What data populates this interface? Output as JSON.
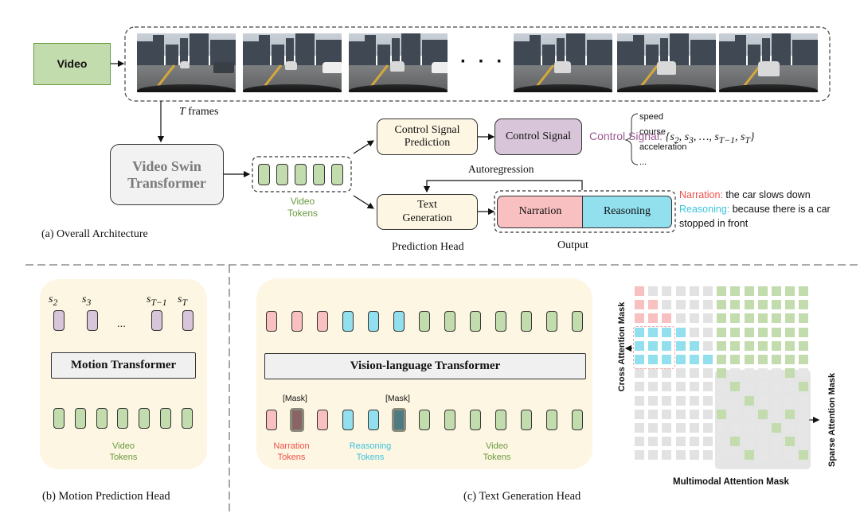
{
  "figure": {
    "overall": {
      "video_label": "Video",
      "frames_label_var": "T",
      "frames_label_text": " frames",
      "ellipsis": "· · ·",
      "frame_count_shown": 6,
      "swin_label_line1": "Video Swin",
      "swin_label_line2": "Transformer",
      "video_tokens_line1": "Video",
      "video_tokens_line2": "Tokens",
      "video_token_count": 5,
      "control_prediction_line1": "Control Signal",
      "control_prediction_line2": "Prediction",
      "control_signal_box": "Control Signal",
      "control_signal_prefix": "Control Signal: ",
      "control_signal_set": "{s₂, s₃, …, s_{T−1}, s_T}",
      "control_signal_items": [
        "speed",
        "course",
        "acceleration",
        "..."
      ],
      "autoregression_label": "Autoregression",
      "text_generation_line1": "Text",
      "text_generation_line2": "Generation",
      "narration_box": "Narration",
      "reasoning_box": "Reasoning",
      "prediction_head_label": "Prediction Head",
      "output_label": "Output",
      "example": {
        "narration_key": "Narration:",
        "narration_value": " the car slows down",
        "reasoning_key": "Reasoning:",
        "reasoning_value": " because there is a car",
        "reasoning_value_line2": "stopped in front"
      },
      "caption": "(a) Overall Architecture"
    },
    "motion_head": {
      "signal_labels": [
        "s₂",
        "s₃",
        "s_{T−1}",
        "s_T"
      ],
      "signal_ellipsis": "...",
      "transformer_label": "Motion Transformer",
      "video_token_count": 7,
      "tokens_line1": "Video",
      "tokens_line2": "Tokens",
      "caption": "(b) Motion Prediction Head"
    },
    "text_head": {
      "top_tokens": [
        "narration",
        "narration",
        "narration",
        "reasoning",
        "reasoning",
        "reasoning",
        "video",
        "video",
        "video",
        "video",
        "video",
        "video",
        "video"
      ],
      "bottom_tokens": [
        "narration",
        "narration-mask",
        "narration",
        "reasoning",
        "reasoning",
        "reasoning-mask",
        "video",
        "video",
        "video",
        "video",
        "video",
        "video",
        "video"
      ],
      "mask_label": "[Mask]",
      "transformer_label": "Vision-language Transformer",
      "narration_tokens_line1": "Narration",
      "narration_tokens_line2": "Tokens",
      "reasoning_tokens_line1": "Reasoning",
      "reasoning_tokens_line2": "Tokens",
      "video_tokens_line1": "Video",
      "video_tokens_line2": "Tokens",
      "caption": "(c) Text Generation Head"
    },
    "attention_mask": {
      "cross_label": "Cross Attention Mask",
      "sparse_label": "Sparse Attention Mask",
      "title": "Multimodal Attention Mask",
      "grid_size": 13,
      "rows": [
        "NGGGGGVVVVVVV",
        "NNGGGGVVVVVVV",
        "NNNGGGVVVVVVV",
        "RRRRGGVVVVVVV",
        "RRRRRGVVVVVVV",
        "RRRRRRVVVVVVV",
        "GGGGGGVssssVs",
        "GGGGGGsVssssV",
        "GGGGGGssVssss",
        "GGGGGGVssVsVs",
        "GGGGGGssssVss",
        "GGGGGGsVsssVs",
        "GGGGGGssVsssV"
      ],
      "legend": {
        "N": "narration",
        "R": "reasoning",
        "V": "video-attended",
        "G": "masked",
        "s": "sparse-masked"
      }
    },
    "colors": {
      "green": "#c2dcae",
      "pink": "#f8c0c0",
      "cyan": "#92dfee",
      "purple": "#d9c5d9",
      "cream": "#fdf6e3",
      "light_gray": "#f0f0f0",
      "narration_text": "#f0504a",
      "reasoning_text": "#3cc3dc",
      "video_text": "#6a9a3c",
      "control_text": "#9a5a90"
    }
  }
}
